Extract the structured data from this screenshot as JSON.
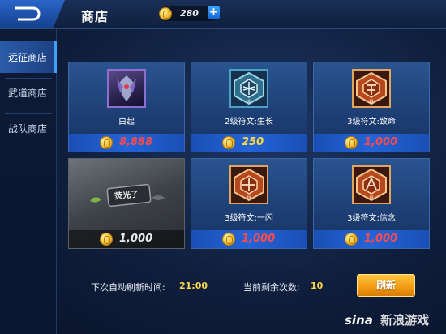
{
  "header": {
    "title": "商店",
    "currency_value": "280",
    "add_label": "+"
  },
  "sidebar": {
    "items": [
      {
        "label": "远征商店",
        "active": true
      },
      {
        "label": "武道商店",
        "active": false
      },
      {
        "label": "战队商店",
        "active": false
      }
    ]
  },
  "shop": {
    "items": [
      {
        "name": "白起",
        "price": "8,888",
        "price_color": "#ff4a4a",
        "icon": "hero-portrait-icon"
      },
      {
        "name": "2级符文:生长",
        "price": "250",
        "price_color": "#ffd93a",
        "icon": "rune-level2-icon"
      },
      {
        "name": "3级符文:致命",
        "price": "1,000",
        "price_color": "#ff4a4a",
        "icon": "rune-level3-icon"
      },
      {
        "name": "",
        "price": "1,000",
        "price_color": "#e6e9ee",
        "icon": "loading-card-icon",
        "badge_text": "荧光了"
      },
      {
        "name": "3级符文:一闪",
        "price": "1,000",
        "price_color": "#ff4a4a",
        "icon": "rune-level3-icon"
      },
      {
        "name": "3级符文:信念",
        "price": "1,000",
        "price_color": "#ff4a4a",
        "icon": "rune-level3-icon"
      }
    ]
  },
  "footer": {
    "refresh_time_label": "下次自动刷新时间:",
    "refresh_time": "21:00",
    "remaining_label": "当前剩余次数:",
    "remaining": "10",
    "refresh_button": "刷新"
  },
  "watermark": {
    "logo": "sina",
    "text": "新浪游戏"
  },
  "colors": {
    "accent_blue": "#2a66c8",
    "button_orange": "#f19a12",
    "price_red": "#ff4a4a",
    "price_yellow": "#ffd93a"
  }
}
